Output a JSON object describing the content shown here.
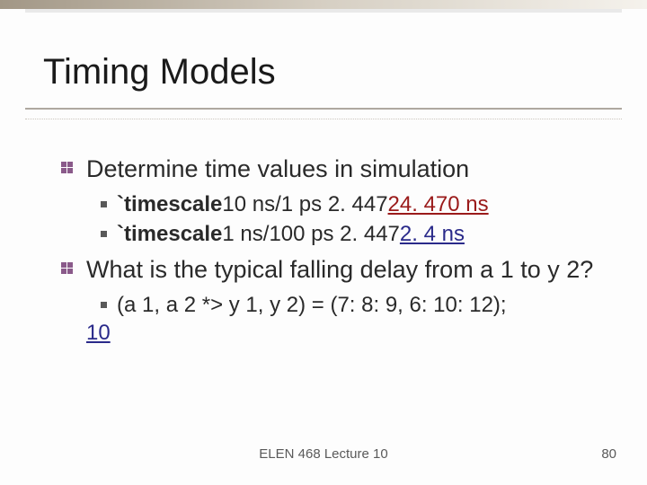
{
  "title": "Timing Models",
  "bullets": [
    {
      "text": "Determine time values in simulation",
      "children": [
        {
          "prefix": "`timescale",
          "rest": " 10 ns/1 ps    2. 447    ",
          "emph": "24. 470 ns",
          "emph_class": "u-red"
        },
        {
          "prefix": "`timescale",
          "rest": " 1 ns/100 ps   2. 447    ",
          "emph": "2. 4 ns",
          "emph_class": "link"
        }
      ]
    },
    {
      "text": "What is the typical falling delay from a 1 to y 2?",
      "children": [
        {
          "prefix": "",
          "rest": " (a 1, a 2 *> y 1, y 2) = (7: 8: 9, 6: 10: 12);      ",
          "emph": "10",
          "emph_class": "link",
          "emph_wrap": true
        }
      ]
    }
  ],
  "footer_center": "ELEN 468 Lecture 10",
  "footer_right": "80"
}
